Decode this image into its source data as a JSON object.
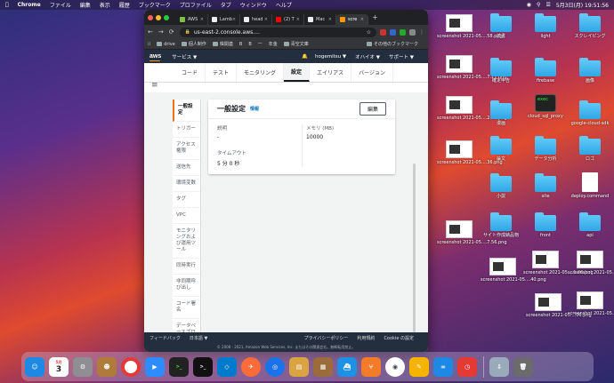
{
  "menubar": {
    "items": [
      "Chrome",
      "ファイル",
      "編集",
      "表示",
      "履歴",
      "ブックマーク",
      "プロファイル",
      "タブ",
      "ウィンドウ",
      "ヘルプ"
    ],
    "clock": "5月3日(月) 19:51:56"
  },
  "browser": {
    "tabs": [
      "AWS",
      "Lamb",
      "head",
      "(2) T",
      "Mac",
      "scre"
    ],
    "url": "us-east-2.console.aws....",
    "bookmarks": [
      "drive",
      "個人制作",
      "株関連",
      "B",
      "B",
      "一",
      "年金",
      "青空文庫"
    ],
    "other_bookmarks": "その他のブックマーク"
  },
  "aws": {
    "logo": "aws",
    "services": "サービス ▼",
    "user": "hogemitsu ▼",
    "region": "オハイオ ▼",
    "support": "サポート ▼",
    "tabs": [
      "コード",
      "テスト",
      "モニタリング",
      "設定",
      "エイリアス",
      "バージョン"
    ],
    "side_nav": [
      "一般設定",
      "トリガー",
      "アクセス権限",
      "送信先",
      "環境変数",
      "タグ",
      "VPC",
      "モニタリングおよび運用ツール",
      "同時実行",
      "非同期呼び出し",
      "コード署名",
      "データベースプロキシ"
    ],
    "panel": {
      "title": "一般設定",
      "info": "情報",
      "edit": "編集",
      "description_label": "説明",
      "description_value": "-",
      "memory_label": "メモリ (MB)",
      "memory_value": "10000",
      "timeout_label": "タイムアウト",
      "timeout_value": "5 分  0 秒"
    },
    "footer": {
      "feedback": "フィードバック",
      "language": "日本語 ▼",
      "privacy": "プライバシーポリシー",
      "terms": "利用規約",
      "cookie": "Cookie の設定",
      "copyright": "© 2008 - 2021, Amazon Web Services, Inc. またはその関連会社。無断転用禁止。"
    }
  },
  "desktop": {
    "col1": [
      "screenshot 2021-05....58.png",
      "screenshot 2021-05....7.11.png",
      "screenshot 2021-05....2.37.png",
      "screenshot 2021-05....36.png",
      "screenshot 2021-05....7.56.png",
      "screenshot 2021-05....40.png",
      "screenshot 2021-05....06.png"
    ],
    "col2_labels": [
      "読書",
      "確定申告",
      "漫画",
      "論文",
      "小説",
      "サイト作成納品物"
    ],
    "col3_labels": [
      "light",
      "firebase",
      "cloud_sql_proxy",
      "データ分析",
      "site",
      "front",
      "screenshot 2021-05....1.00.png"
    ],
    "col4_labels": [
      "スクレイピング",
      "画像",
      "google-cloud-sdk",
      "ロゴ",
      "deploy.command",
      "api",
      "screenshot 2021-05....5.21.png",
      "screenshot 2021-05....29.png"
    ]
  },
  "dock": {
    "calendar_month": "5月",
    "calendar_day": "3"
  }
}
